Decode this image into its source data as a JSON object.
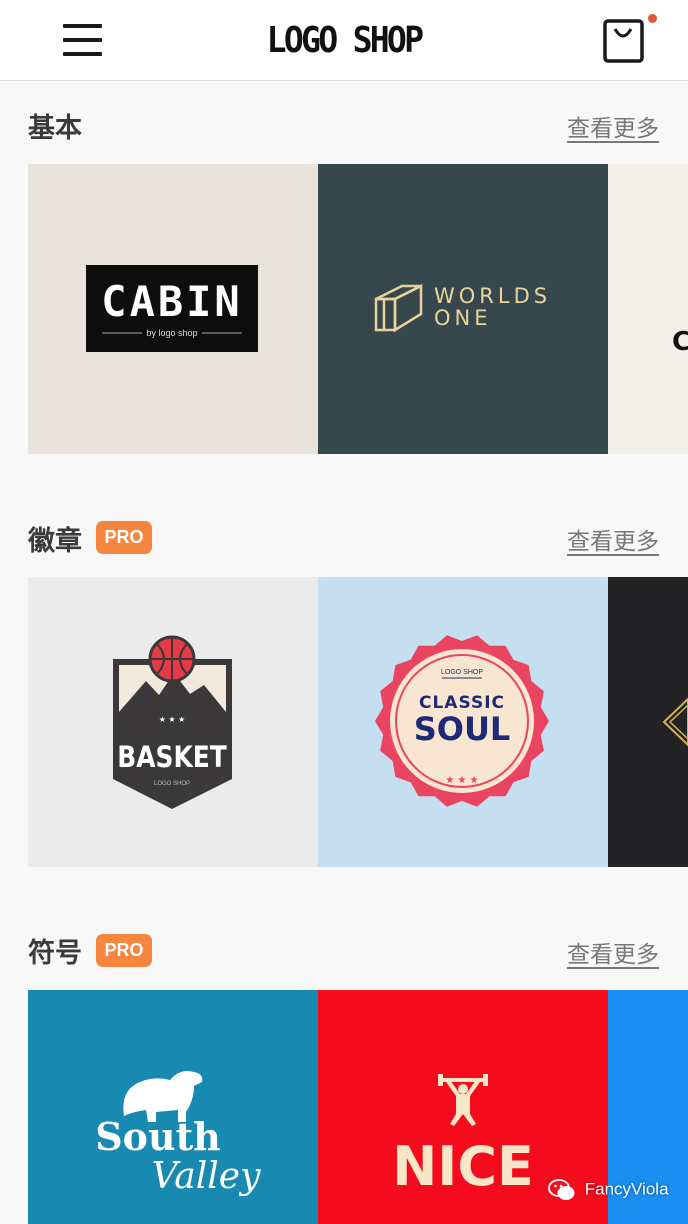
{
  "header": {
    "brand": "LOGO SHOP",
    "menu_icon": "hamburger-menu-icon",
    "cart_icon": "shopping-bag-icon",
    "cart_dot_color": "#e5533b"
  },
  "sections": [
    {
      "title": "基本",
      "more_label": "查看更多",
      "tiles": [
        {
          "bg": "#e8e4da",
          "text": "CABIN",
          "subtext": "by logo shop"
        },
        {
          "bg": "#37474e",
          "text1": "WORLDS",
          "text2": "ONE"
        },
        {
          "bg": "#f2efe8",
          "text": "C"
        }
      ]
    },
    {
      "title": "徽章",
      "badge": "PRO",
      "badge_color": "#f5853f",
      "more_label": "查看更多",
      "tiles": [
        {
          "bg": "#ebebeb",
          "text": "BASKET",
          "subtext": "LOGO SHOP"
        },
        {
          "bg": "#c5def0",
          "text1": "CLASSIC",
          "text2": "SOUL",
          "subtext": "LOGO SHOP"
        },
        {
          "bg": "#232325"
        }
      ]
    },
    {
      "title": "符号",
      "badge": "PRO",
      "badge_color": "#f5853f",
      "more_label": "查看更多",
      "tiles": [
        {
          "bg": "#1889b0",
          "text1": "South",
          "text2": "Valley"
        },
        {
          "bg": "#f40c1c",
          "text": "NICE"
        },
        {
          "bg": "#1b8ff1"
        }
      ]
    }
  ],
  "watermark": "FancyViola"
}
